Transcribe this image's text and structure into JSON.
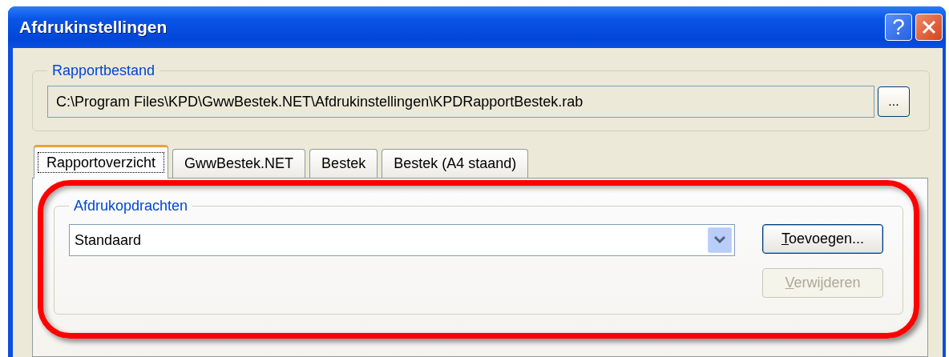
{
  "window": {
    "title": "Afdrukinstellingen",
    "controls": [
      {
        "kind": "help",
        "label": "?"
      },
      {
        "kind": "close"
      }
    ]
  },
  "report_file": {
    "legend": "Rapportbestand",
    "path": "C:\\Program Files\\KPD\\GwwBestek.NET\\Afdrukinstellingen\\KPDRapportBestek.rab",
    "browse_button": "..."
  },
  "tabs": [
    {
      "label": "Rapportoverzicht",
      "selected": true
    },
    {
      "label": "GwwBestek.NET",
      "selected": false
    },
    {
      "label": "Bestek",
      "selected": false
    },
    {
      "label": "Bestek (A4 staand)",
      "selected": false
    }
  ],
  "print_jobs": {
    "legend": "Afdrukopdrachten",
    "value": "Standaard",
    "buttons": [
      {
        "label": "Toevoegen...",
        "disabled": false
      },
      {
        "label": "Verwijderen",
        "disabled": true
      }
    ]
  }
}
